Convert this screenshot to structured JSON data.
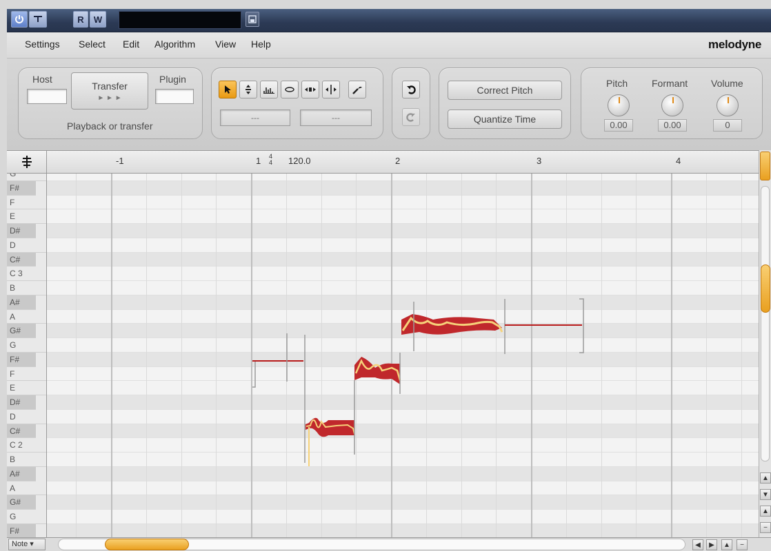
{
  "titlebar": {
    "r_label": "R",
    "w_label": "W"
  },
  "menu": {
    "items": [
      "Settings",
      "Select",
      "Edit",
      "Algorithm",
      "View",
      "Help"
    ],
    "logo": "melodyne"
  },
  "transfer": {
    "host_label": "Host",
    "transfer_label": "Transfer",
    "plugin_label": "Plugin",
    "arrows": "► ► ►",
    "status": "Playback or transfer"
  },
  "tools": {
    "readout_left": "---",
    "readout_right": "---"
  },
  "macros": {
    "correct_pitch": "Correct Pitch",
    "quantize_time": "Quantize Time"
  },
  "knobs": {
    "pitch": {
      "label": "Pitch",
      "value": "0.00"
    },
    "formant": {
      "label": "Formant",
      "value": "0.00"
    },
    "volume": {
      "label": "Volume",
      "value": "0"
    }
  },
  "ruler": {
    "markers": [
      "-1",
      "1",
      "2",
      "3",
      "4"
    ],
    "time_sig_top": "4",
    "time_sig_bottom": "4",
    "tempo": "120.0"
  },
  "piano_keys": [
    "G",
    "F#",
    "F",
    "E",
    "D#",
    "D",
    "C#",
    "C 3",
    "B",
    "A#",
    "A",
    "G#",
    "G",
    "F#",
    "F",
    "E",
    "D#",
    "D",
    "C#",
    "C 2",
    "B",
    "A#",
    "A",
    "G#",
    "G",
    "F#"
  ],
  "bottom": {
    "mode": "Note"
  },
  "colors": {
    "blob_dark": "#c0282c",
    "blob_light": "#f6d27a",
    "line": "#b81b1b",
    "accent": "#e9a020"
  }
}
